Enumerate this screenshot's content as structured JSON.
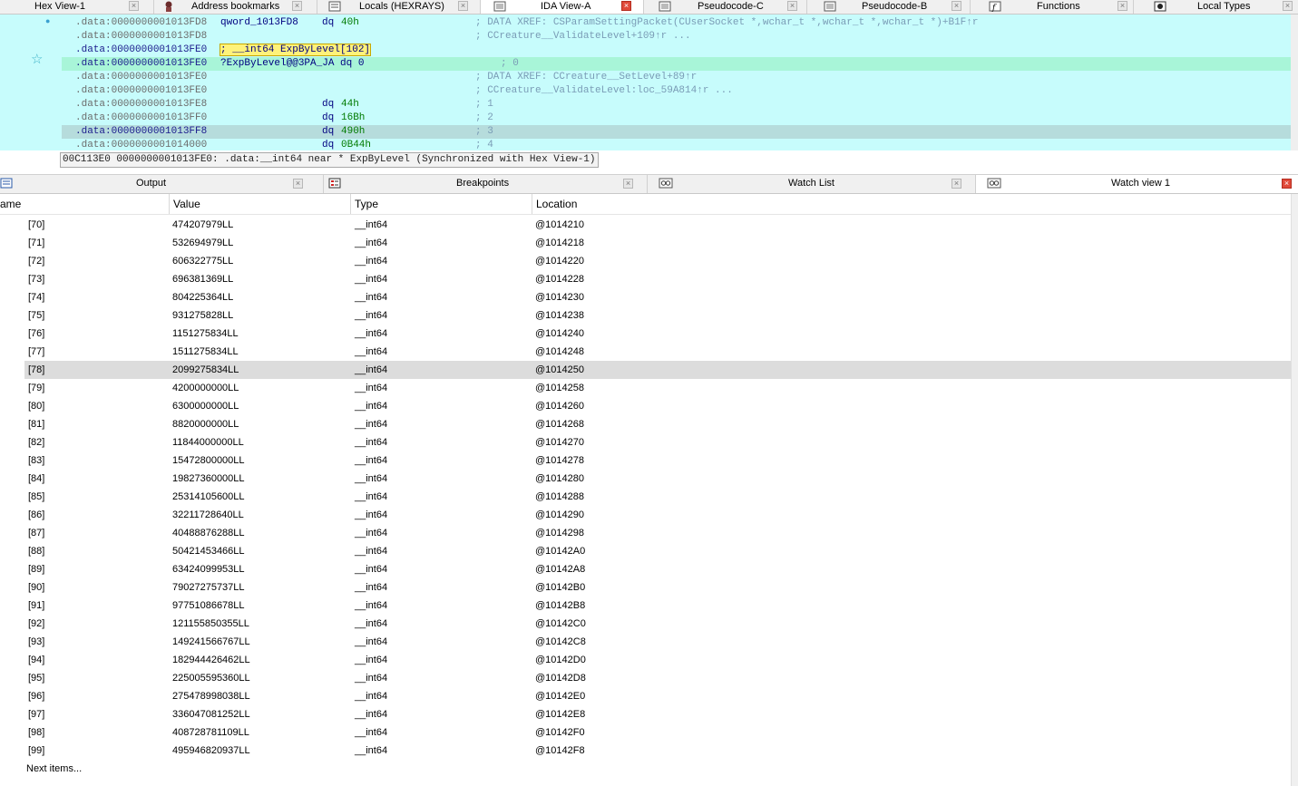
{
  "top_tabs": [
    {
      "label": "Hex View-1",
      "icon": "hex-icon",
      "active": false
    },
    {
      "label": "Address bookmarks",
      "icon": "bookmark-icon",
      "active": false
    },
    {
      "label": "Locals (HEXRAYS)",
      "icon": "locals-icon",
      "active": false
    },
    {
      "label": "IDA View-A",
      "icon": "ida-view-icon",
      "active": true
    },
    {
      "label": "Pseudocode-C",
      "icon": "pseudocode-icon",
      "active": false
    },
    {
      "label": "Pseudocode-B",
      "icon": "pseudocode-icon",
      "active": false
    },
    {
      "label": "Functions",
      "icon": "functions-icon",
      "active": false
    },
    {
      "label": "Local Types",
      "icon": "local-types-icon",
      "active": false
    }
  ],
  "ida": {
    "lines": [
      {
        "addr": ".data:0000000001013FD8",
        "label": "qword_1013FD8",
        "mnem": "dq",
        "operand": "40h",
        "comment": "; DATA XREF: CSParamSettingPacket(CUserSocket *,wchar_t *,wchar_t *,wchar_t *)+B1F↑r"
      },
      {
        "addr": ".data:0000000001013FD8",
        "label": "",
        "mnem": "",
        "operand": "",
        "comment": "; CCreature__ValidateLevel+109↑r ..."
      },
      {
        "addr": ".data:0000000001013FE0",
        "label": "; __int64 ExpByLevel[102]",
        "mnem": "",
        "operand": "",
        "comment": ""
      },
      {
        "addr": ".data:0000000001013FE0",
        "label": "?ExpByLevel@@3PA_JA dq 0",
        "mnem": "",
        "operand": "",
        "comment": "; 0"
      },
      {
        "addr": ".data:0000000001013FE0",
        "label": "",
        "mnem": "",
        "operand": "",
        "comment": "; DATA XREF: CCreature__SetLevel+89↑r"
      },
      {
        "addr": ".data:0000000001013FE0",
        "label": "",
        "mnem": "",
        "operand": "",
        "comment": "; CCreature__ValidateLevel:loc_59A814↑r ..."
      },
      {
        "addr": ".data:0000000001013FE8",
        "label": "",
        "mnem": "dq",
        "operand": "44h",
        "comment": "; 1"
      },
      {
        "addr": ".data:0000000001013FF0",
        "label": "",
        "mnem": "dq",
        "operand": "16Bh",
        "comment": "; 2"
      },
      {
        "addr": ".data:0000000001013FF8",
        "label": "",
        "mnem": "dq",
        "operand": "490h",
        "comment": "; 3"
      },
      {
        "addr": ".data:0000000001014000",
        "label": "",
        "mnem": "dq",
        "operand": "0B44h",
        "comment": "; 4"
      }
    ],
    "status": "00C113E0 0000000001013FE0: .data:__int64 near * ExpByLevel (Synchronized with Hex View-1)"
  },
  "bottom_tabs": [
    {
      "label": "Output",
      "icon": "output-icon",
      "active": false
    },
    {
      "label": "Breakpoints",
      "icon": "breakpoints-icon",
      "active": false
    },
    {
      "label": "Watch List",
      "icon": "watch-icon",
      "active": false
    },
    {
      "label": "Watch view 1",
      "icon": "watch-icon",
      "active": true
    }
  ],
  "watch": {
    "columns": {
      "name": "ame",
      "value": "Value",
      "type": "Type",
      "location": "Location"
    },
    "rows": [
      {
        "name": "[70]",
        "value": "474207979LL",
        "type": "__int64",
        "location": "@1014210"
      },
      {
        "name": "[71]",
        "value": "532694979LL",
        "type": "__int64",
        "location": "@1014218"
      },
      {
        "name": "[72]",
        "value": "606322775LL",
        "type": "__int64",
        "location": "@1014220"
      },
      {
        "name": "[73]",
        "value": "696381369LL",
        "type": "__int64",
        "location": "@1014228"
      },
      {
        "name": "[74]",
        "value": "804225364LL",
        "type": "__int64",
        "location": "@1014230"
      },
      {
        "name": "[75]",
        "value": "931275828LL",
        "type": "__int64",
        "location": "@1014238"
      },
      {
        "name": "[76]",
        "value": "1151275834LL",
        "type": "__int64",
        "location": "@1014240"
      },
      {
        "name": "[77]",
        "value": "1511275834LL",
        "type": "__int64",
        "location": "@1014248"
      },
      {
        "name": "[78]",
        "value": "2099275834LL",
        "type": "__int64",
        "location": "@1014250"
      },
      {
        "name": "[79]",
        "value": "4200000000LL",
        "type": "__int64",
        "location": "@1014258"
      },
      {
        "name": "[80]",
        "value": "6300000000LL",
        "type": "__int64",
        "location": "@1014260"
      },
      {
        "name": "[81]",
        "value": "8820000000LL",
        "type": "__int64",
        "location": "@1014268"
      },
      {
        "name": "[82]",
        "value": "11844000000LL",
        "type": "__int64",
        "location": "@1014270"
      },
      {
        "name": "[83]",
        "value": "15472800000LL",
        "type": "__int64",
        "location": "@1014278"
      },
      {
        "name": "[84]",
        "value": "19827360000LL",
        "type": "__int64",
        "location": "@1014280"
      },
      {
        "name": "[85]",
        "value": "25314105600LL",
        "type": "__int64",
        "location": "@1014288"
      },
      {
        "name": "[86]",
        "value": "32211728640LL",
        "type": "__int64",
        "location": "@1014290"
      },
      {
        "name": "[87]",
        "value": "40488876288LL",
        "type": "__int64",
        "location": "@1014298"
      },
      {
        "name": "[88]",
        "value": "50421453466LL",
        "type": "__int64",
        "location": "@10142A0"
      },
      {
        "name": "[89]",
        "value": "63424099953LL",
        "type": "__int64",
        "location": "@10142A8"
      },
      {
        "name": "[90]",
        "value": "79027275737LL",
        "type": "__int64",
        "location": "@10142B0"
      },
      {
        "name": "[91]",
        "value": "97751086678LL",
        "type": "__int64",
        "location": "@10142B8"
      },
      {
        "name": "[92]",
        "value": "121155850355LL",
        "type": "__int64",
        "location": "@10142C0"
      },
      {
        "name": "[93]",
        "value": "149241566767LL",
        "type": "__int64",
        "location": "@10142C8"
      },
      {
        "name": "[94]",
        "value": "182944426462LL",
        "type": "__int64",
        "location": "@10142D0"
      },
      {
        "name": "[95]",
        "value": "225005595360LL",
        "type": "__int64",
        "location": "@10142D8"
      },
      {
        "name": "[96]",
        "value": "275478998038LL",
        "type": "__int64",
        "location": "@10142E0"
      },
      {
        "name": "[97]",
        "value": "336047081252LL",
        "type": "__int64",
        "location": "@10142E8"
      },
      {
        "name": "[98]",
        "value": "408728781109LL",
        "type": "__int64",
        "location": "@10142F0"
      },
      {
        "name": "[99]",
        "value": "495946820937LL",
        "type": "__int64",
        "location": "@10142F8"
      }
    ],
    "selected_row": "[78]",
    "next_items": "Next items..."
  },
  "colors": {
    "disasm_bg": "#c7fcfc",
    "current_line": "#a8f5d8",
    "selected_line": "#b6dcdc",
    "close_active": "#e04a3a"
  }
}
